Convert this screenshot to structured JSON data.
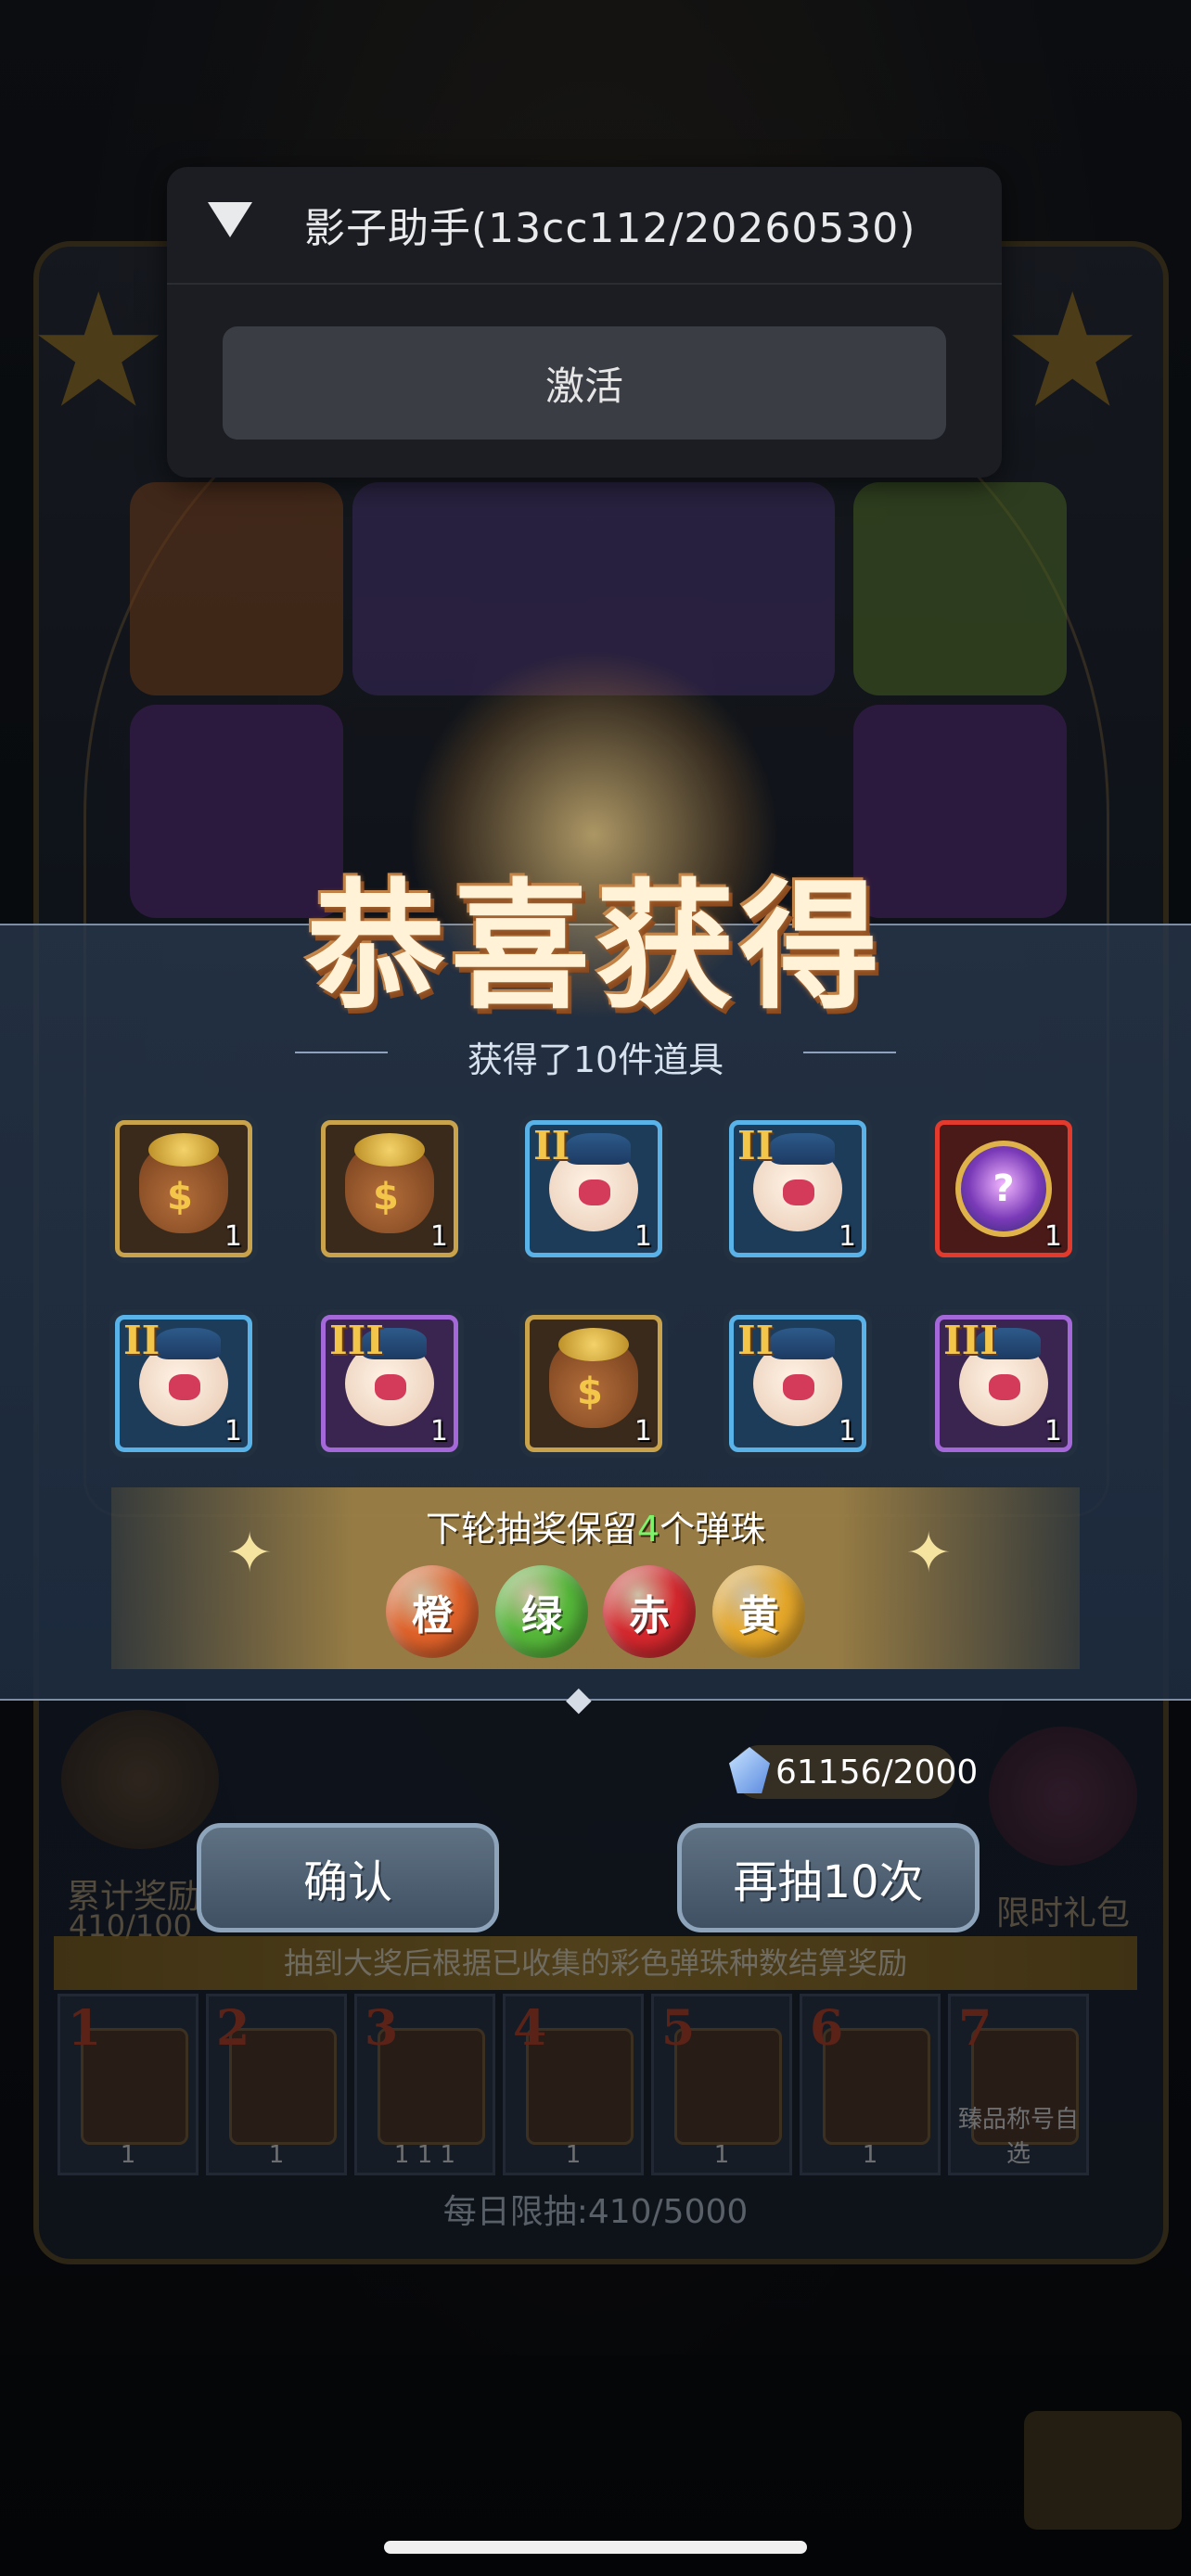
{
  "helper": {
    "title": "影子助手(13cc112/20260530)",
    "activate_label": "激活"
  },
  "reward": {
    "title": "恭喜获得",
    "subtitle": "获得了10件道具",
    "items": [
      {
        "type": "coin-bag",
        "frame": "gold",
        "rank": "",
        "qty": "1"
      },
      {
        "type": "coin-bag",
        "frame": "gold",
        "rank": "",
        "qty": "1"
      },
      {
        "type": "orb-creature",
        "frame": "blue",
        "rank": "II",
        "qty": "1"
      },
      {
        "type": "orb-creature",
        "frame": "blue",
        "rank": "II",
        "qty": "1"
      },
      {
        "type": "medal",
        "frame": "red",
        "rank": "",
        "qty": "1"
      },
      {
        "type": "orb-creature",
        "frame": "blue",
        "rank": "II",
        "qty": "1"
      },
      {
        "type": "orb-creature",
        "frame": "purple",
        "rank": "III",
        "qty": "1"
      },
      {
        "type": "coin-bag",
        "frame": "gold",
        "rank": "",
        "qty": "1"
      },
      {
        "type": "orb-creature",
        "frame": "blue",
        "rank": "II",
        "qty": "1"
      },
      {
        "type": "orb-creature",
        "frame": "purple",
        "rank": "III",
        "qty": "1"
      }
    ],
    "retain_prefix": "下轮抽奖保留",
    "retain_count": "4",
    "retain_suffix": "个弹珠",
    "marbles": [
      {
        "label": "橙",
        "color": "#e0622a"
      },
      {
        "label": "绿",
        "color": "#56b83a"
      },
      {
        "label": "赤",
        "color": "#d6282e"
      },
      {
        "label": "黄",
        "color": "#e6a82a"
      }
    ]
  },
  "actions": {
    "confirm_label": "确认",
    "redraw_label": "再抽10次"
  },
  "game": {
    "currency": "61156/2000",
    "accum_label": "累计奖励",
    "accum_count": "410/100",
    "gift_label": "限时礼包",
    "info_text": "抽到大奖后根据已收集的彩色弹珠种数结算奖励",
    "slots": [
      {
        "n": "1",
        "cap": "1"
      },
      {
        "n": "2",
        "cap": "1"
      },
      {
        "n": "3",
        "cap": "1 1 1"
      },
      {
        "n": "4",
        "cap": "1"
      },
      {
        "n": "5",
        "cap": "1"
      },
      {
        "n": "6",
        "cap": "1"
      },
      {
        "n": "7",
        "cap": "臻品称号自选"
      }
    ],
    "daily_limit": "每日限抽:410/5000"
  },
  "colors": {
    "accent_gold": "#c9a24c",
    "band_border": "#7d8ea4",
    "retain_number": "#7ef26a"
  }
}
